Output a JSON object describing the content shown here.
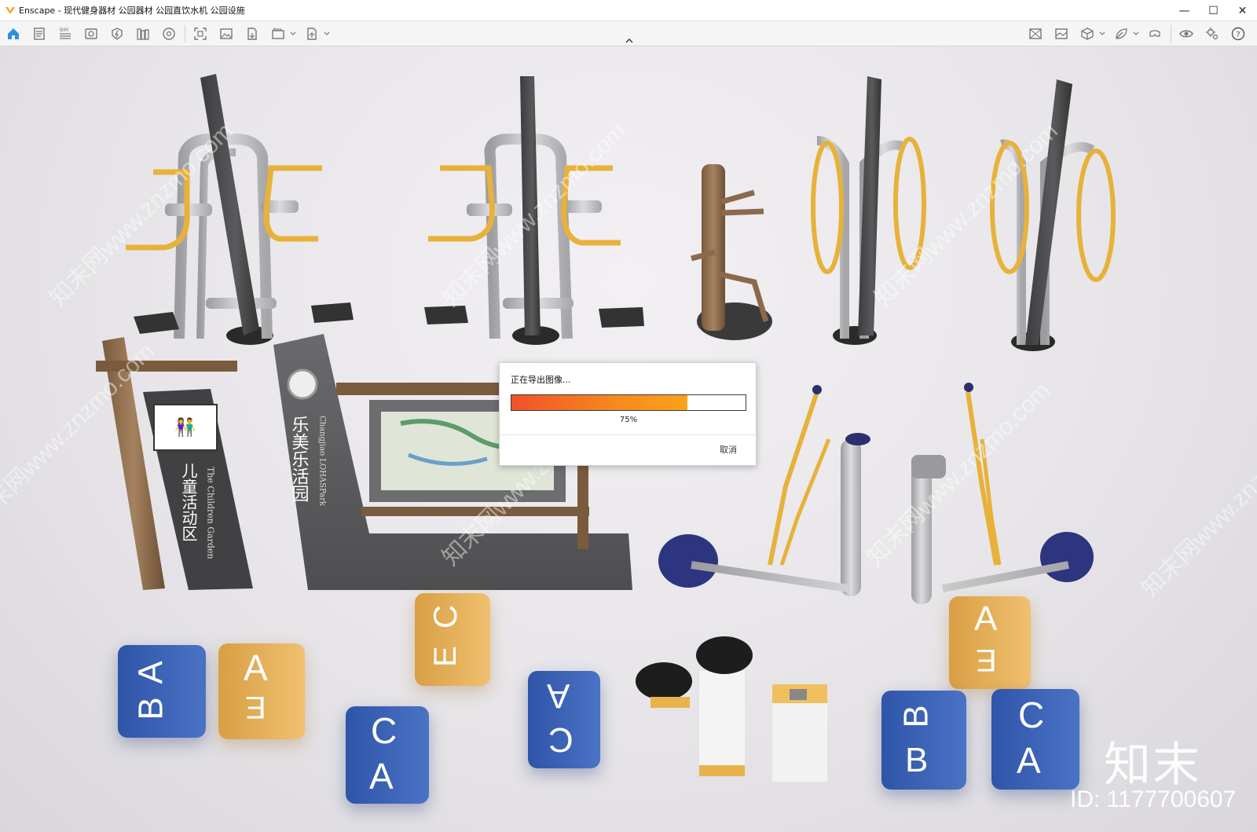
{
  "window": {
    "title": "Enscape - 现代健身器材 公园器材 公园直饮水机 公园设施",
    "minimize": "—",
    "maximize": "☐",
    "close": "✕"
  },
  "toolbar": {
    "left_icons": [
      "home-icon",
      "document-icon",
      "bim-icon",
      "view-icon",
      "lightning-icon",
      "library-icon",
      "asset-icon",
      "screenshot-icon",
      "image-icon",
      "export-icon",
      "video-icon",
      "upload-icon"
    ],
    "right_icons": [
      "map-icon",
      "gallery-icon",
      "cube-icon",
      "leaf-icon",
      "vr-headset-icon",
      "eye-icon",
      "settings-icon",
      "help-icon"
    ],
    "bim_label": "BIM"
  },
  "dialog": {
    "title": "正在导出图像...",
    "progress": 0.75,
    "progress_label": "75%",
    "cancel": "取消"
  },
  "scene": {
    "sign_children": "儿童活动区",
    "sign_children_en": "The Children Garden",
    "sign_park": "乐美乐活园",
    "sign_park_en": "Changjiao LOHASPark",
    "cube_letters": [
      "A",
      "B",
      "E",
      "C",
      "A",
      "A",
      "C",
      "A",
      "B",
      "E",
      "C",
      "A"
    ]
  },
  "watermark": {
    "brand": "知末",
    "id": "ID: 1177700607",
    "diag": "知末网www.znzmo.com"
  },
  "colors": {
    "accent_orange": "#f78a1d",
    "cube_blue": "#3a62b5",
    "cube_yellow": "#e6b25a",
    "equipment_yellow": "#e7b23a",
    "equipment_gray": "#bcbcbe",
    "post_dark": "#4a4a4c",
    "wood": "#8a6a4c"
  }
}
